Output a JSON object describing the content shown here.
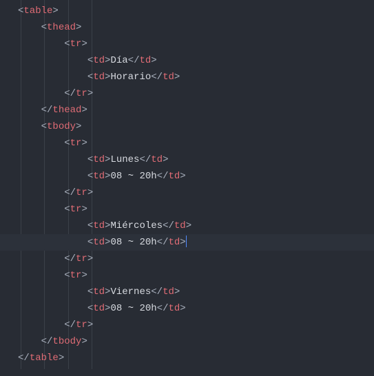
{
  "indent_guides": {
    "count": 4
  },
  "highlighted_line_index": 14,
  "cursor": {
    "line_index": 14,
    "at_end": true
  },
  "lines": [
    {
      "indent": 0,
      "tokens": [
        {
          "k": "p",
          "v": "<"
        },
        {
          "k": "t",
          "v": "table"
        },
        {
          "k": "p",
          "v": ">"
        }
      ]
    },
    {
      "indent": 1,
      "tokens": [
        {
          "k": "p",
          "v": "<"
        },
        {
          "k": "t",
          "v": "thead"
        },
        {
          "k": "p",
          "v": ">"
        }
      ]
    },
    {
      "indent": 2,
      "tokens": [
        {
          "k": "p",
          "v": "<"
        },
        {
          "k": "t",
          "v": "tr"
        },
        {
          "k": "p",
          "v": ">"
        }
      ]
    },
    {
      "indent": 3,
      "tokens": [
        {
          "k": "p",
          "v": "<"
        },
        {
          "k": "t",
          "v": "td"
        },
        {
          "k": "p",
          "v": ">"
        },
        {
          "k": "tx",
          "v": "Día"
        },
        {
          "k": "p",
          "v": "</"
        },
        {
          "k": "t",
          "v": "td"
        },
        {
          "k": "p",
          "v": ">"
        }
      ]
    },
    {
      "indent": 3,
      "tokens": [
        {
          "k": "p",
          "v": "<"
        },
        {
          "k": "t",
          "v": "td"
        },
        {
          "k": "p",
          "v": ">"
        },
        {
          "k": "tx",
          "v": "Horario"
        },
        {
          "k": "p",
          "v": "</"
        },
        {
          "k": "t",
          "v": "td"
        },
        {
          "k": "p",
          "v": ">"
        }
      ]
    },
    {
      "indent": 2,
      "tokens": [
        {
          "k": "p",
          "v": "</"
        },
        {
          "k": "t",
          "v": "tr"
        },
        {
          "k": "p",
          "v": ">"
        }
      ]
    },
    {
      "indent": 1,
      "tokens": [
        {
          "k": "p",
          "v": "</"
        },
        {
          "k": "t",
          "v": "thead"
        },
        {
          "k": "p",
          "v": ">"
        }
      ]
    },
    {
      "indent": 1,
      "tokens": [
        {
          "k": "p",
          "v": "<"
        },
        {
          "k": "t",
          "v": "tbody"
        },
        {
          "k": "p",
          "v": ">"
        }
      ]
    },
    {
      "indent": 2,
      "tokens": [
        {
          "k": "p",
          "v": "<"
        },
        {
          "k": "t",
          "v": "tr"
        },
        {
          "k": "p",
          "v": ">"
        }
      ]
    },
    {
      "indent": 3,
      "tokens": [
        {
          "k": "p",
          "v": "<"
        },
        {
          "k": "t",
          "v": "td"
        },
        {
          "k": "p",
          "v": ">"
        },
        {
          "k": "tx",
          "v": "Lunes"
        },
        {
          "k": "p",
          "v": "</"
        },
        {
          "k": "t",
          "v": "td"
        },
        {
          "k": "p",
          "v": ">"
        }
      ]
    },
    {
      "indent": 3,
      "tokens": [
        {
          "k": "p",
          "v": "<"
        },
        {
          "k": "t",
          "v": "td"
        },
        {
          "k": "p",
          "v": ">"
        },
        {
          "k": "tx",
          "v": "08 ~ 20h"
        },
        {
          "k": "p",
          "v": "</"
        },
        {
          "k": "t",
          "v": "td"
        },
        {
          "k": "p",
          "v": ">"
        }
      ]
    },
    {
      "indent": 2,
      "tokens": [
        {
          "k": "p",
          "v": "</"
        },
        {
          "k": "t",
          "v": "tr"
        },
        {
          "k": "p",
          "v": ">"
        }
      ]
    },
    {
      "indent": 2,
      "tokens": [
        {
          "k": "p",
          "v": "<"
        },
        {
          "k": "t",
          "v": "tr"
        },
        {
          "k": "p",
          "v": ">"
        }
      ]
    },
    {
      "indent": 3,
      "tokens": [
        {
          "k": "p",
          "v": "<"
        },
        {
          "k": "t",
          "v": "td"
        },
        {
          "k": "p",
          "v": ">"
        },
        {
          "k": "tx",
          "v": "Miércoles"
        },
        {
          "k": "p",
          "v": "</"
        },
        {
          "k": "t",
          "v": "td"
        },
        {
          "k": "p",
          "v": ">"
        }
      ]
    },
    {
      "indent": 3,
      "tokens": [
        {
          "k": "p",
          "v": "<"
        },
        {
          "k": "t",
          "v": "td"
        },
        {
          "k": "p",
          "v": ">"
        },
        {
          "k": "tx",
          "v": "08 ~ 20h"
        },
        {
          "k": "p",
          "v": "</"
        },
        {
          "k": "t",
          "v": "td"
        },
        {
          "k": "p",
          "v": ">"
        }
      ]
    },
    {
      "indent": 2,
      "tokens": [
        {
          "k": "p",
          "v": "</"
        },
        {
          "k": "t",
          "v": "tr"
        },
        {
          "k": "p",
          "v": ">"
        }
      ]
    },
    {
      "indent": 2,
      "tokens": [
        {
          "k": "p",
          "v": "<"
        },
        {
          "k": "t",
          "v": "tr"
        },
        {
          "k": "p",
          "v": ">"
        }
      ]
    },
    {
      "indent": 3,
      "tokens": [
        {
          "k": "p",
          "v": "<"
        },
        {
          "k": "t",
          "v": "td"
        },
        {
          "k": "p",
          "v": ">"
        },
        {
          "k": "tx",
          "v": "Viernes"
        },
        {
          "k": "p",
          "v": "</"
        },
        {
          "k": "t",
          "v": "td"
        },
        {
          "k": "p",
          "v": ">"
        }
      ]
    },
    {
      "indent": 3,
      "tokens": [
        {
          "k": "p",
          "v": "<"
        },
        {
          "k": "t",
          "v": "td"
        },
        {
          "k": "p",
          "v": ">"
        },
        {
          "k": "tx",
          "v": "08 ~ 20h"
        },
        {
          "k": "p",
          "v": "</"
        },
        {
          "k": "t",
          "v": "td"
        },
        {
          "k": "p",
          "v": ">"
        }
      ]
    },
    {
      "indent": 2,
      "tokens": [
        {
          "k": "p",
          "v": "</"
        },
        {
          "k": "t",
          "v": "tr"
        },
        {
          "k": "p",
          "v": ">"
        }
      ]
    },
    {
      "indent": 1,
      "tokens": [
        {
          "k": "p",
          "v": "</"
        },
        {
          "k": "t",
          "v": "tbody"
        },
        {
          "k": "p",
          "v": ">"
        }
      ]
    },
    {
      "indent": 0,
      "tokens": [
        {
          "k": "p",
          "v": "</"
        },
        {
          "k": "t",
          "v": "table"
        },
        {
          "k": "p",
          "v": ">"
        }
      ]
    }
  ]
}
